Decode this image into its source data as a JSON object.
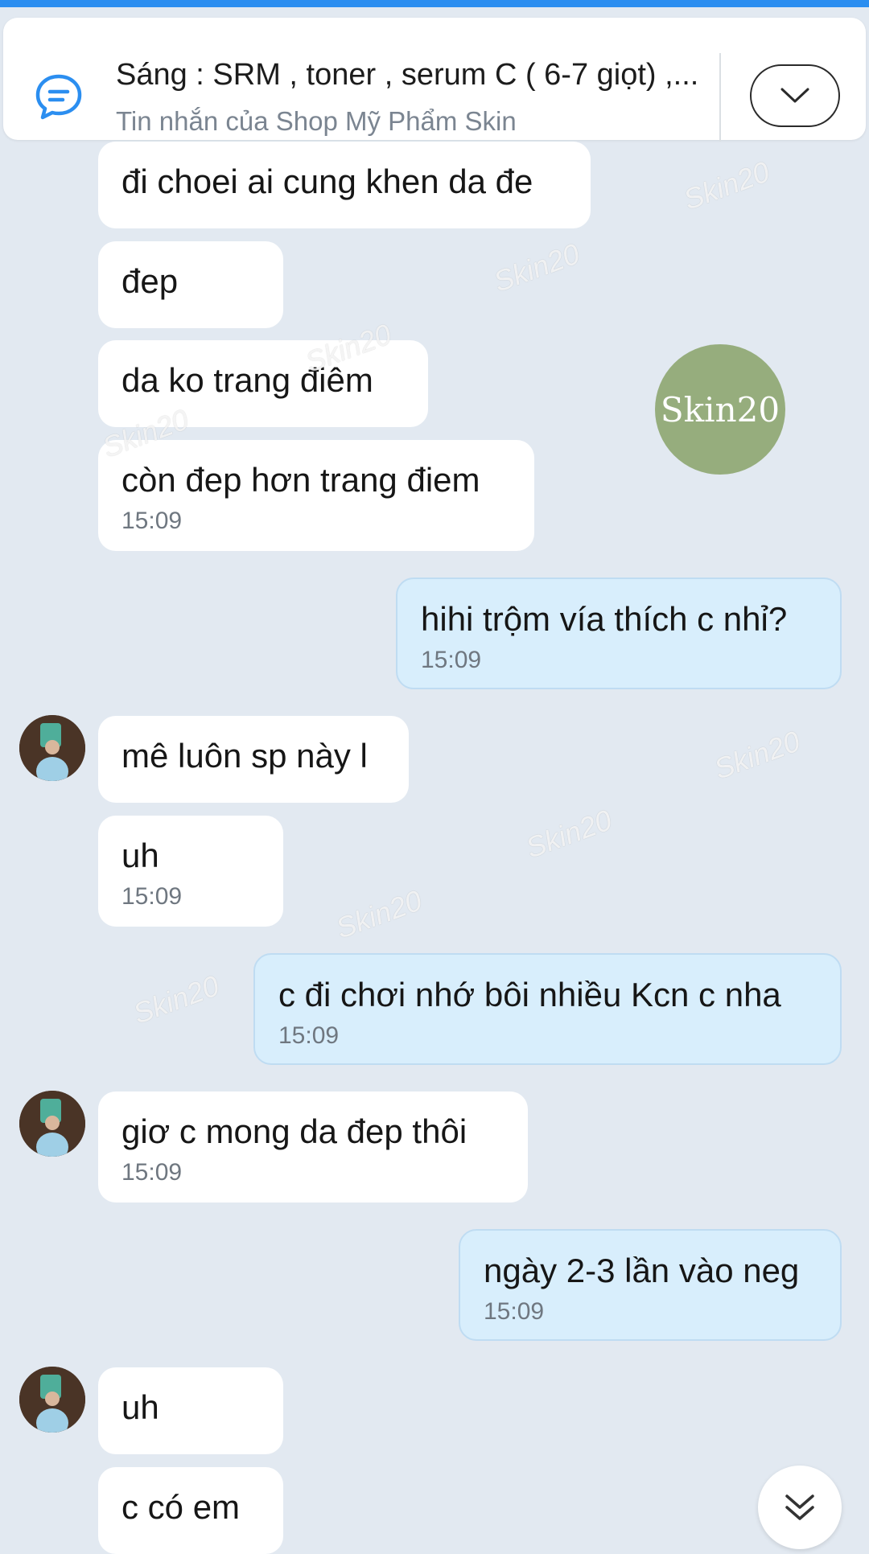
{
  "pinned": {
    "title": "Sáng : SRM , toner , serum C ( 6-7 giọt) ,...",
    "subtitle": "Tin nhắn của Shop Mỹ Phẩm Skin"
  },
  "watermark": {
    "text": "Skin20",
    "logo_text": "Skin20",
    "logo_color": "#96ad7d"
  },
  "messages": [
    {
      "text": "đi choei ai cung khen da đe",
      "time": ""
    },
    {
      "text": "đep",
      "time": ""
    },
    {
      "text": "da ko trang điêm",
      "time": ""
    },
    {
      "text": "còn đep hơn trang điem",
      "time": "15:09"
    },
    {
      "text": "hihi trộm vía thích c nhỉ?",
      "time": "15:09"
    },
    {
      "text": "mê luôn sp này l",
      "time": ""
    },
    {
      "text": "uh",
      "time": "15:09"
    },
    {
      "text": "c đi chơi nhớ bôi nhiều Kcn c nha",
      "time": "15:09"
    },
    {
      "text": "giơ c mong da đep thôi",
      "time": "15:09"
    },
    {
      "text": "ngày 2-3 lần vào neg",
      "time": "15:09"
    },
    {
      "text": "uh",
      "time": ""
    },
    {
      "text": "c có em",
      "time": ""
    }
  ],
  "colors": {
    "incoming_bubble": "#ffffff",
    "outgoing_bubble": "#d8eefc",
    "background": "#e2e9f1",
    "accent": "#2b8ef0"
  },
  "icons": {
    "pinned": "chat-message-icon",
    "toggle": "chevron-down-icon",
    "scroll": "double-chevron-down-icon"
  }
}
